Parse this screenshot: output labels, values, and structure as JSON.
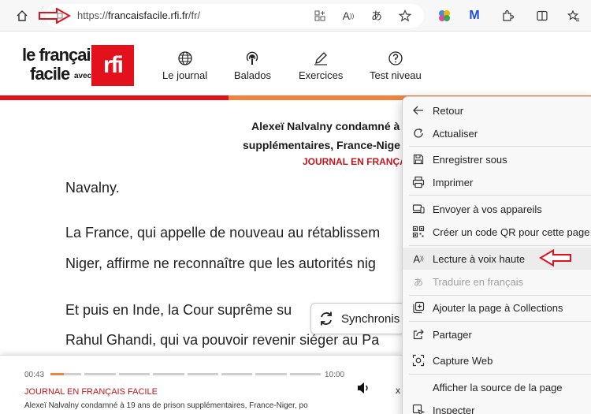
{
  "browser": {
    "url_prefix": "https://",
    "url_host": "francaisfacile.rfi.fr",
    "url_path": "/fr/",
    "icons": [
      "home-icon",
      "site-info-icon",
      "apps-icon",
      "read-aloud-icon",
      "translate-icon",
      "favorite-icon",
      "copilot-icon",
      "malwarebytes-icon",
      "extensions-icon",
      "split-screen-icon",
      "favorites-bar-icon"
    ]
  },
  "site": {
    "logo_line1": "le français",
    "logo_line2": "facile",
    "logo_avec": "avec",
    "logo_rfi": "rfi",
    "nav": [
      {
        "label": "Le journal",
        "icon": "globe-icon"
      },
      {
        "label": "Balados",
        "icon": "podcast-icon"
      },
      {
        "label": "Exercices",
        "icon": "pencil-icon"
      },
      {
        "label": "Test niveau",
        "icon": "question-icon"
      }
    ],
    "brand_red": "#e3111b",
    "brand_orange": "#f3823f"
  },
  "article": {
    "title_line1": "Alexeï Nalvalny condamné à",
    "title_line2": "supplémentaires, France-Nige",
    "tag": "JOURNAL EN FRANÇA",
    "p1": "Navalny.",
    "p2": "La France, qui appelle de nouveau au rétablissem",
    "p3": "Niger, affirme ne reconnaître que les autorités nig",
    "p4": "Et puis en Inde, la Cour suprême su",
    "p5": "Rahul Ghandi, qui va pouvoir revenir siéger au Pa",
    "sync_label": "Synchronis"
  },
  "player": {
    "time_current": "00:43",
    "time_total": "10:00",
    "progress": 0.05,
    "tag": "JOURNAL EN FRANÇAIS FACILE",
    "title": "Alexeï Nalvalny condamné à 19 ans de prison supplémentaires, France-Niger, po",
    "close": "x"
  },
  "context_menu": {
    "items": [
      {
        "label": "Retour",
        "icon": "back-arrow-icon",
        "disabled": false
      },
      {
        "label": "Actualiser",
        "icon": "refresh-icon",
        "disabled": false
      },
      {
        "label": "Enregistrer sous",
        "icon": "save-icon",
        "disabled": false
      },
      {
        "label": "Imprimer",
        "icon": "print-icon",
        "disabled": false
      },
      {
        "label": "Envoyer à vos appareils",
        "icon": "devices-icon",
        "disabled": false
      },
      {
        "label": "Créer un code QR pour cette page",
        "icon": "qr-code-icon",
        "disabled": false
      },
      {
        "label": "Lecture à voix haute",
        "icon": "read-aloud-icon",
        "disabled": false
      },
      {
        "label": "Traduire en français",
        "icon": "translate-icon",
        "disabled": true
      },
      {
        "label": "Ajouter la page à Collections",
        "icon": "collections-icon",
        "disabled": false
      },
      {
        "label": "Partager",
        "icon": "share-icon",
        "disabled": false
      },
      {
        "label": "Capture Web",
        "icon": "web-capture-icon",
        "disabled": false
      },
      {
        "label": "Afficher la source de la page",
        "icon": "",
        "disabled": false
      },
      {
        "label": "Inspecter",
        "icon": "",
        "disabled": false
      }
    ]
  }
}
